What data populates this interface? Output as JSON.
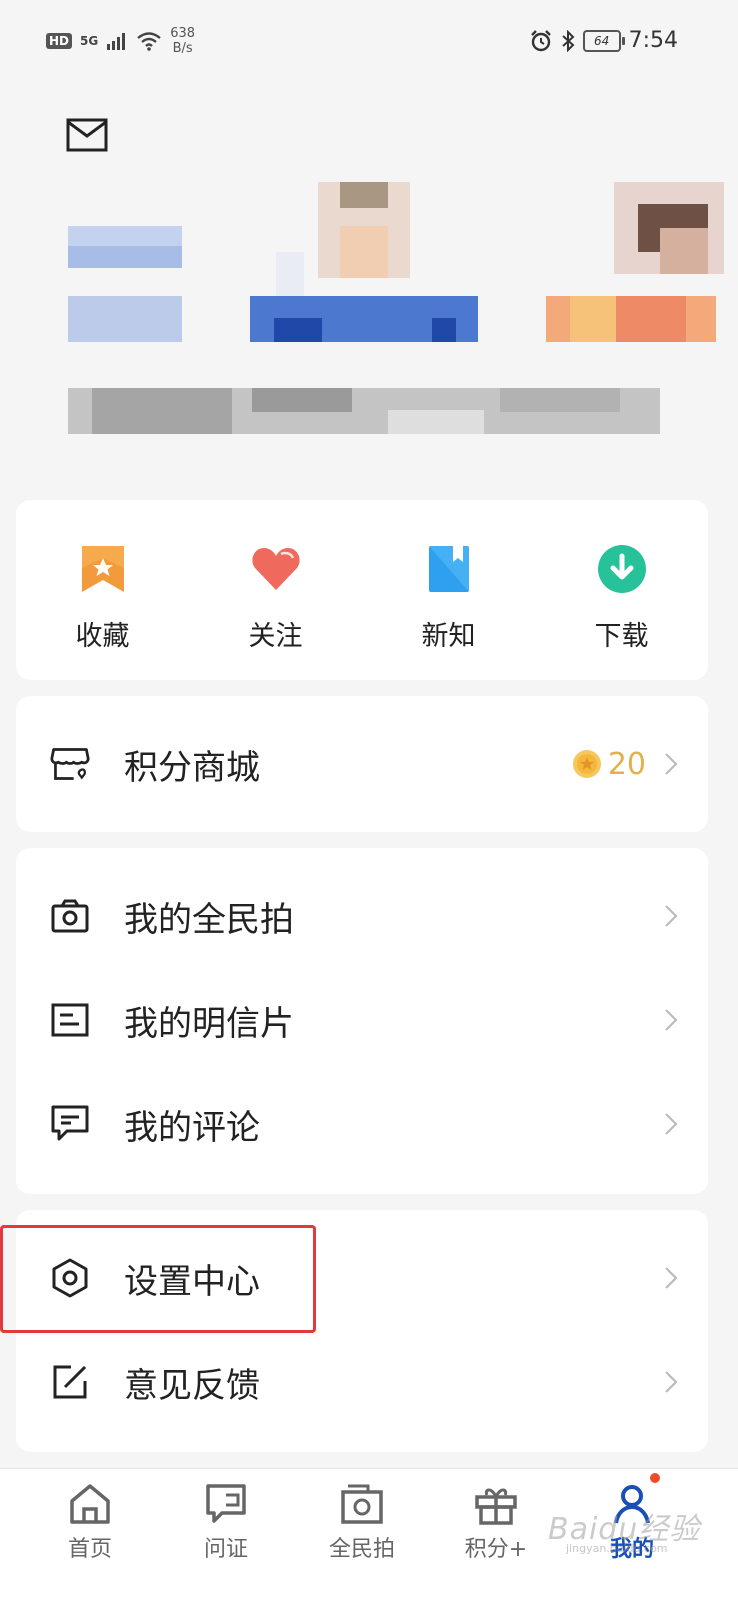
{
  "status_bar": {
    "hd": "HD",
    "network": "5G",
    "speed_value": "638",
    "speed_unit": "B/s",
    "battery": "64",
    "time": "7:54"
  },
  "quick_actions": [
    {
      "label": "收藏",
      "icon": "bookmark-star-icon"
    },
    {
      "label": "关注",
      "icon": "heart-icon"
    },
    {
      "label": "新知",
      "icon": "book-icon"
    },
    {
      "label": "下载",
      "icon": "download-icon"
    }
  ],
  "points_mall": {
    "label": "积分商城",
    "points": "20",
    "icon": "shop-icon"
  },
  "menu_group_1": [
    {
      "label": "我的全民拍",
      "icon": "camera-icon"
    },
    {
      "label": "我的明信片",
      "icon": "postcard-icon"
    },
    {
      "label": "我的评论",
      "icon": "comment-icon"
    }
  ],
  "menu_group_2": [
    {
      "label": "设置中心",
      "icon": "settings-hexagon-icon"
    },
    {
      "label": "意见反馈",
      "icon": "edit-feedback-icon"
    }
  ],
  "bottom_nav": [
    {
      "label": "首页",
      "icon": "home-icon"
    },
    {
      "label": "问证",
      "icon": "question-card-icon"
    },
    {
      "label": "全民拍",
      "icon": "camera-frame-icon"
    },
    {
      "label": "积分+",
      "icon": "gift-icon"
    },
    {
      "label": "我的",
      "icon": "profile-icon",
      "active": true
    }
  ],
  "watermark": {
    "text": "Baidu经验",
    "sub": "jingyan.baidu.com"
  },
  "colors": {
    "accent": "#1a4fb5",
    "highlight_border": "#e23a3a",
    "coin": "#e0b24e",
    "notification_dot": "#ef4a2a"
  }
}
